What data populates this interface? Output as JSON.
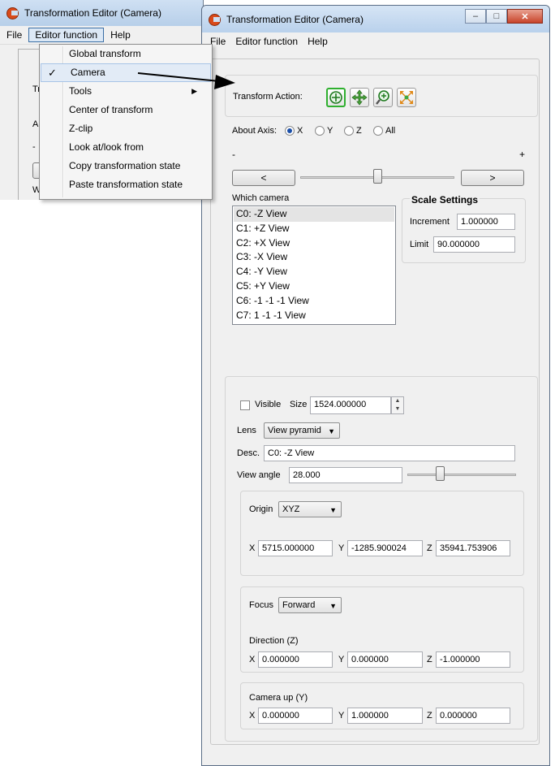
{
  "background_window": {
    "title": "Transformation Editor (Camera)",
    "menu": [
      "File",
      "Editor function",
      "Help"
    ],
    "fragments": [
      "Tr",
      "A",
      "-",
      "W"
    ]
  },
  "dropdown_menu": {
    "items": [
      {
        "label": "Global transform",
        "checked": false,
        "submenu": false
      },
      {
        "label": "Camera",
        "checked": true,
        "submenu": false
      },
      {
        "label": "Tools",
        "checked": false,
        "submenu": true
      },
      {
        "label": "Center of transform",
        "checked": false,
        "submenu": false
      },
      {
        "label": "Z-clip",
        "checked": false,
        "submenu": false
      },
      {
        "label": "Look at/look from",
        "checked": false,
        "submenu": false
      },
      {
        "label": "Copy transformation state",
        "checked": false,
        "submenu": false
      },
      {
        "label": "Paste transformation state",
        "checked": false,
        "submenu": false
      }
    ],
    "check_glyph": "✓",
    "submenu_glyph": "▶"
  },
  "window": {
    "title": "Transformation Editor (Camera)",
    "controls": {
      "minimize": "–",
      "maximize": "□",
      "close": "✕"
    },
    "menu": [
      "File",
      "Editor function",
      "Help"
    ]
  },
  "transform": {
    "action_label": "Transform Action:",
    "tools": [
      {
        "icon": "rotate-icon",
        "selected": true
      },
      {
        "icon": "translate-icon",
        "selected": false
      },
      {
        "icon": "zoom-icon",
        "selected": false
      },
      {
        "icon": "scale-icon",
        "selected": false
      }
    ],
    "about_axis_label": "About Axis:",
    "axes": [
      {
        "label": "X",
        "selected": true
      },
      {
        "label": "Y",
        "selected": false
      },
      {
        "label": "Z",
        "selected": false
      },
      {
        "label": "All",
        "selected": false
      }
    ],
    "minus_label": "-",
    "plus_label": "+",
    "left_button": "<",
    "right_button": ">",
    "slider_position": 0.5
  },
  "cameras": {
    "label": "Which camera",
    "items": [
      "C0: -Z View",
      "C1: +Z View",
      "C2: +X View",
      "C3: -X View",
      "C4: -Y View",
      "C5: +Y View",
      "C6: -1 -1 -1 View",
      "C7: 1 -1 -1 View"
    ],
    "selected_index": 0
  },
  "scale_settings": {
    "title": "Scale Settings",
    "increment_label": "Increment",
    "increment_value": "1.000000",
    "limit_label": "Limit",
    "limit_value": "90.000000"
  },
  "camera_props": {
    "visible_label": "Visible",
    "visible_checked": false,
    "size_label": "Size",
    "size_value": "1524.000000",
    "spin_up": "▲",
    "spin_down": "▼",
    "lens_label": "Lens",
    "lens_value": "View pyramid",
    "desc_label": "Desc.",
    "desc_value": "C0: -Z View",
    "view_angle_label": "View angle",
    "view_angle_value": "28.000",
    "view_angle_slider": 0.3,
    "combo_caret": "▼"
  },
  "origin": {
    "label": "Origin",
    "mode": "XYZ",
    "x_label": "X",
    "x_value": "5715.000000",
    "y_label": "Y",
    "y_value": "-1285.900024",
    "z_label": "Z",
    "z_value": "35941.753906"
  },
  "focus": {
    "label": "Focus",
    "mode": "Forward",
    "direction_label": "Direction (Z)",
    "x_label": "X",
    "x_value": "0.000000",
    "y_label": "Y",
    "y_value": "0.000000",
    "z_label": "Z",
    "z_value": "-1.000000"
  },
  "camera_up": {
    "label": "Camera up (Y)",
    "x_label": "X",
    "x_value": "0.000000",
    "y_label": "Y",
    "y_value": "1.000000",
    "z_label": "Z",
    "z_value": "0.000000"
  }
}
